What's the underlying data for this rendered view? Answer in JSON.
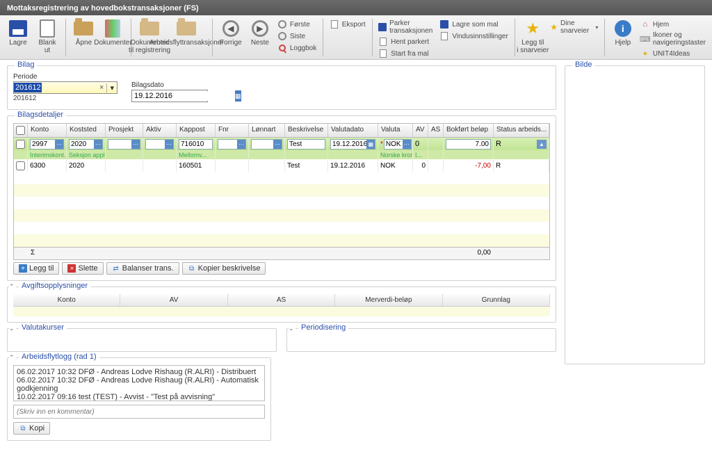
{
  "window": {
    "title": "Mottaksregistrering av hovedbokstransaksjoner (FS)"
  },
  "toolbar": {
    "lagre": "Lagre",
    "blank_ut": "Blank\nut",
    "apne": "Åpne",
    "dokumenter": "Dokumenter",
    "dok_reg": "Dokumenter\ntil registrering",
    "arbeidsflyt": "Arbeidsflyttransaksjoner",
    "forrige": "Forrige",
    "neste": "Neste",
    "forste": "Første",
    "siste": "Siste",
    "loggbok": "Loggbok",
    "eksport": "Eksport",
    "parker": "Parker transaksjonen",
    "hent_parkert": "Hent parkert",
    "start_mal": "Start fra mal",
    "lagre_mal": "Lagre som mal",
    "vindus": "Vindusinnstillinger",
    "legg_snarvei": "Legg til\ni snarveier",
    "dine_snarveier": "Dine snarveier",
    "hjelp": "Hjelp",
    "hjem": "Hjem",
    "ikoner": "Ikoner og navigeringstaster",
    "unit4": "UNIT4Ideas"
  },
  "bilag": {
    "legend": "Bilag",
    "periode_label": "Periode",
    "periode_value": "201612",
    "periode_hint": "201612",
    "bilagsdato_label": "Bilagsdato",
    "bilagsdato_value": "19.12.2016"
  },
  "bilde": {
    "legend": "Bilde"
  },
  "details": {
    "legend": "Bilagsdetaljer",
    "headers": {
      "konto": "Konto",
      "koststed": "Koststed",
      "prosjekt": "Prosjekt",
      "aktiv": "Aktiv",
      "kappost": "Kappost",
      "fnr": "Fnr",
      "lonnart": "Lønnart",
      "beskrivelse": "Beskrivelse",
      "valutadato": "Valutadato",
      "valuta": "Valuta",
      "av": "AV",
      "as": "AS",
      "bokfort": "Bokført beløp",
      "status": "Status arbeids..."
    },
    "rows": [
      {
        "konto": "2997",
        "konto_sub": "Interimskont...",
        "koststed": "2020",
        "koststed_sub": "Seksjon appli...",
        "prosjekt": "",
        "aktiv": "",
        "kappost": "716010",
        "kappost_sub": "Mellomv...",
        "fnr": "",
        "lonnart": "",
        "beskrivelse": "Test",
        "valutadato": "19.12.2016",
        "valuta": "NOK",
        "valuta_sub": "Norske kroner",
        "av": "0",
        "av_sub": "I...",
        "as": "",
        "belop": "7.00",
        "status": "R",
        "selected": true
      },
      {
        "konto": "6300",
        "koststed": "2020",
        "prosjekt": "",
        "aktiv": "",
        "kappost": "160501",
        "fnr": "",
        "lonnart": "",
        "beskrivelse": "Test",
        "valutadato": "19.12.2016",
        "valuta": "NOK",
        "av": "0",
        "as": "",
        "belop": "-7,00",
        "status": "R",
        "selected": false
      }
    ],
    "sigma": "Σ",
    "total": "0,00"
  },
  "actions": {
    "legg_til": "Legg til",
    "slette": "Slette",
    "balanser": "Balanser trans.",
    "kopier_besk": "Kopier beskrivelse"
  },
  "avgift": {
    "legend": "Avgiftsopplysninger",
    "cols": {
      "konto": "Konto",
      "av": "AV",
      "as": "AS",
      "merverdi": "Merverdi-beløp",
      "grunnlag": "Grunnlag"
    }
  },
  "valutakurser": {
    "legend": "Valutakurser"
  },
  "periodisering": {
    "legend": "Periodisering"
  },
  "flytlogg": {
    "legend": "Arbeidsflytlogg (rad 1)",
    "lines": [
      "06.02.2017 10:32 DFØ - Andreas Lodve Rishaug (R.ALRI) - Distribuert",
      "06.02.2017 10:32 DFØ - Andreas Lodve Rishaug (R.ALRI) - Automatisk godkjenning",
      "10.02.2017 09:16 test (TEST) - Avvist - \"Test på avvisning\""
    ],
    "comment_placeholder": "(Skriv inn en kommentar)",
    "kopi": "Kopi"
  }
}
